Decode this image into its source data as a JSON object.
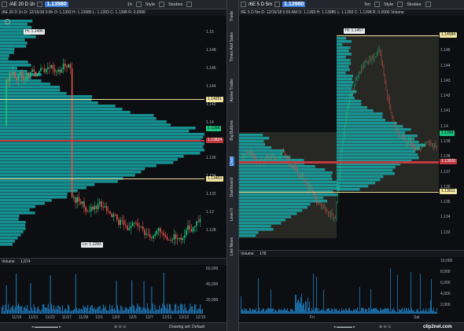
{
  "left": {
    "symbol": "/AE 20 D 1h",
    "price": "1.13980",
    "interval": "1h",
    "style_label": "Style",
    "studies_label": "Studies",
    "header": "/AE 20 D 1h  D: 12/15/18 0:0h  O: 1.1393  H: 1.13985  L: 1.1393  C: 1.1398  R: 0.0006",
    "y_ticks": [
      "1.15",
      "1.148",
      "1.146",
      "1.144",
      "1.142",
      "1.14",
      "1.138",
      "1.136",
      "1.134",
      "1.132",
      "1.13",
      "1.128"
    ],
    "levels": {
      "top": "1.14251",
      "current": "1.1398",
      "red": "1.13824",
      "bottom": "1.13453"
    },
    "hi_label": "Hi: 1.1495",
    "lo_label": "Lo: 1.1283",
    "volume_label": "Volume",
    "volume_value": "1,674",
    "vol_ticks": [
      "60,000",
      "40,000",
      "20,000"
    ],
    "x_ticks": [
      "11/19",
      "11/21",
      "11/23",
      "11/27",
      "11/28",
      "12/1",
      "12/3",
      "12/5",
      "12/7",
      "12/11",
      "12/13",
      "12/15"
    ],
    "status_text": "Drawing set: Default",
    "colors": {
      "up": "#19c37d",
      "down": "#e2544a",
      "profile": "#1aa7a8",
      "level": "#f2e6a2",
      "red": "#c0393f"
    }
  },
  "right": {
    "symbol": "/6E 5 D 5m",
    "price": "1.13980",
    "interval": "5m",
    "style_label": "Style",
    "studies_label": "Studies",
    "header": "/6E 5 D 5m  D: 12/15/18 5:55 AM  O: 1.1393  H: 1.13985  L: 1.1393  C: 1.1398  R: 0.0006  Volume",
    "y_ticks": [
      "1.146",
      "1.145",
      "1.144",
      "1.143",
      "1.142",
      "1.141",
      "1.14",
      "1.139",
      "1.138",
      "1.137",
      "1.136",
      "1.135",
      "1.134",
      "1.133"
    ],
    "levels": {
      "top": "1.14584",
      "current": "1.1398",
      "red": "1.13820",
      "bottom": "1.13611"
    },
    "hi_label": "Hi: 1.1457",
    "volume_label": "Volume",
    "volume_value": "178",
    "vol_ticks": [
      "10,000",
      "8,000",
      "6,000",
      "4,000",
      "2,000"
    ],
    "x_ticks": [
      "Fri",
      "Sat"
    ],
    "watermark": "clip2net.com"
  },
  "sidebar": {
    "tabs": [
      "Trade",
      "Times And Sales",
      "Active Trader",
      "Big Buttons",
      "Chart",
      "Dashboard",
      "Level II",
      "Live News"
    ]
  }
}
